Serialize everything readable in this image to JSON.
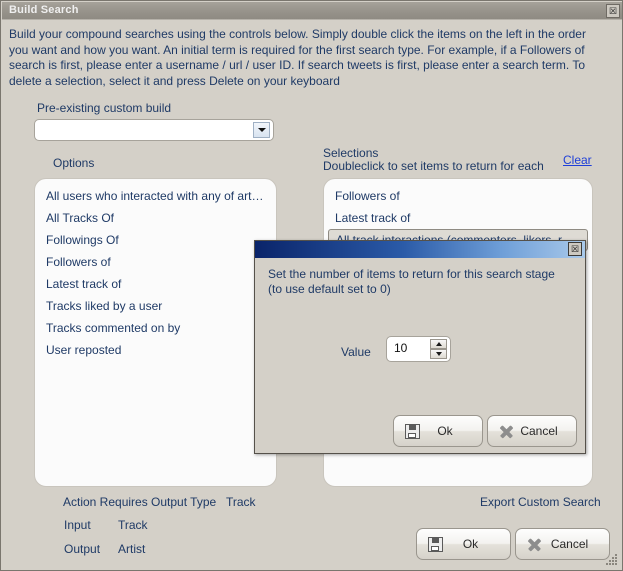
{
  "window": {
    "title": "Build Search",
    "close_icon": "☒",
    "description": "Build your compound searches using the controls below. Simply double click the items on the left in the order you want and how you want.  An initial term is required for the first search type. For example, if a Followers of search is first, please enter a username / url  / user ID. If search tweets is first, please enter a search term. To delete a selection, select it and press Delete on your keyboard"
  },
  "prebuild": {
    "label": "Pre-existing custom build",
    "value": "",
    "placeholder": ""
  },
  "options": {
    "label": "Options",
    "items": [
      "All users who interacted with any of artists...",
      "All Tracks Of",
      "Followings Of",
      "Followers of",
      "Latest track of",
      "Tracks liked by a user",
      "Tracks commented on by",
      "User reposted"
    ]
  },
  "selections": {
    "label": "Selections",
    "sublabel": "Doubleclick to set items to return for each",
    "clear_label": "Clear",
    "items": [
      {
        "text": "Followers of",
        "selected": false
      },
      {
        "text": "Latest track of",
        "selected": false
      },
      {
        "text": "All track interactions (commenters, likers, repost...",
        "selected": true
      }
    ]
  },
  "info": {
    "action_label": "Action Requires Output Type",
    "action_value": "Track",
    "input_label": "Input",
    "input_value": "Track",
    "output_label": "Output",
    "output_value": "Artist"
  },
  "footer": {
    "export_label": "Export Custom Search",
    "ok_label": "Ok",
    "cancel_label": "Cancel"
  },
  "modal": {
    "title": "",
    "close_icon": "☒",
    "message": "Set the number of items to return for this search stage (to use default set to 0)",
    "value_label": "Value",
    "value": "10",
    "ok_label": "Ok",
    "cancel_label": "Cancel"
  },
  "colors": {
    "window_bg": "#d4d0c8",
    "text": "#1f3a66",
    "link": "#1e3fd8",
    "modal_title_start": "#0a246a",
    "modal_title_end": "#a9c9ea"
  }
}
